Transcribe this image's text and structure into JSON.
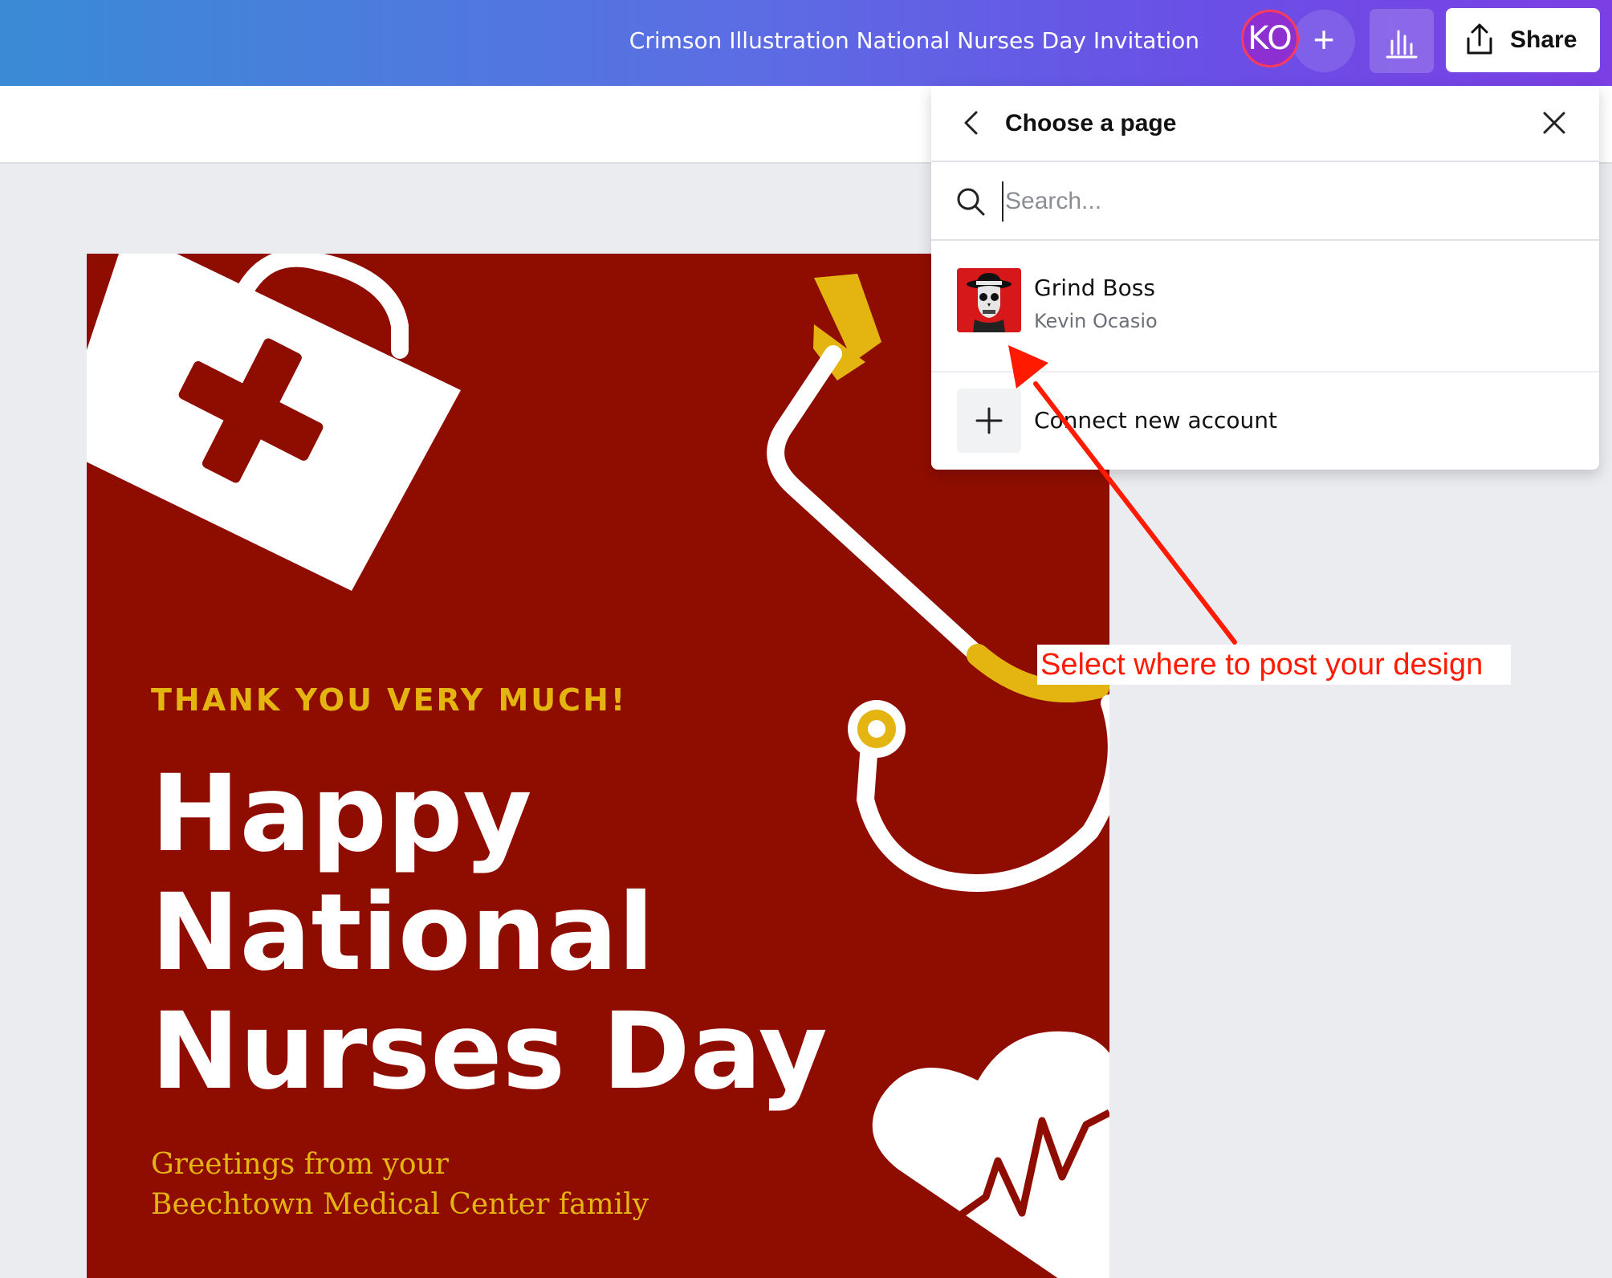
{
  "header": {
    "doc_title": "Crimson Illustration National Nurses Day Invitation",
    "avatar_initials": "KO",
    "add_label": "+",
    "share_label": "Share"
  },
  "canvas": {
    "kicker": "THANK YOU VERY MUCH!",
    "headline": [
      "Happy",
      "National",
      "Nurses Day"
    ],
    "greeting": [
      "Greetings from your",
      "Beechtown Medical Center family"
    ],
    "colors": {
      "background": "#8f0d00",
      "accent": "#e4b511",
      "text": "#ffffff"
    }
  },
  "panel": {
    "title": "Choose a page",
    "search_placeholder": "Search...",
    "account": {
      "name": "Grind Boss",
      "owner": "Kevin Ocasio"
    },
    "connect_label": "Connect new account"
  },
  "annotation": {
    "callout": "Select where to post your design",
    "color": "#ff1a00"
  }
}
